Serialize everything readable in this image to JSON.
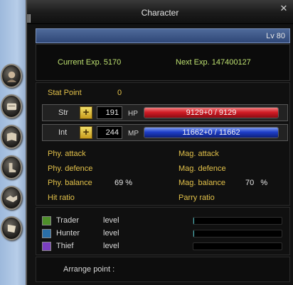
{
  "window": {
    "title": "Character"
  },
  "level": {
    "text": "Lv 80"
  },
  "exp": {
    "current": "Current Exp. 5170",
    "next": "Next Exp. 147400127"
  },
  "stat_point": {
    "label": "Stat Point",
    "value": "0"
  },
  "attributes": [
    {
      "name": "Str",
      "value": "191",
      "gauge_label": "HP",
      "gauge_text": "9129+0 / 9129",
      "fill_percent": 100,
      "color": "#d21c26"
    },
    {
      "name": "Int",
      "value": "244",
      "gauge_label": "MP",
      "gauge_text": "11662+0 / 11662",
      "fill_percent": 100,
      "color": "#1f3fc9"
    }
  ],
  "properties": {
    "phy_attack": {
      "label": "Phy. attack",
      "value": ""
    },
    "mag_attack": {
      "label": "Mag. attack",
      "value": ""
    },
    "phy_defence": {
      "label": "Phy. defence",
      "value": ""
    },
    "mag_defence": {
      "label": "Mag. defence",
      "value": ""
    },
    "phy_balance": {
      "label": "Phy. balance",
      "value": "69 %"
    },
    "mag_balance": {
      "label": "Mag. balance",
      "value": "70   %"
    },
    "hit_ratio": {
      "label": "Hit ratio",
      "value": ""
    },
    "parry_ratio": {
      "label": "Parry ratio",
      "value": ""
    }
  },
  "jobs": [
    {
      "name": "Trader",
      "level_label": "level",
      "progress_percent": 1,
      "icon": "trader-icon",
      "icon_color": "#4e8f2a"
    },
    {
      "name": "Hunter",
      "level_label": "level",
      "progress_percent": 1,
      "icon": "hunter-icon",
      "icon_color": "#2a6fa8"
    },
    {
      "name": "Thief",
      "level_label": "level",
      "progress_percent": 0,
      "icon": "thief-icon",
      "icon_color": "#7b3fc0"
    }
  ],
  "arrange": {
    "label": "Arrange point :"
  },
  "side_tabs": [
    {
      "icon": "character-face-icon"
    },
    {
      "icon": "scroll-icon"
    },
    {
      "icon": "book-icon"
    },
    {
      "icon": "boot-icon"
    },
    {
      "icon": "handshake-icon"
    },
    {
      "icon": "map-scroll-icon"
    }
  ],
  "colors": {
    "accent_gold": "#e2c14a",
    "exp_green": "#bde070",
    "level_bar": "#3a5588"
  }
}
